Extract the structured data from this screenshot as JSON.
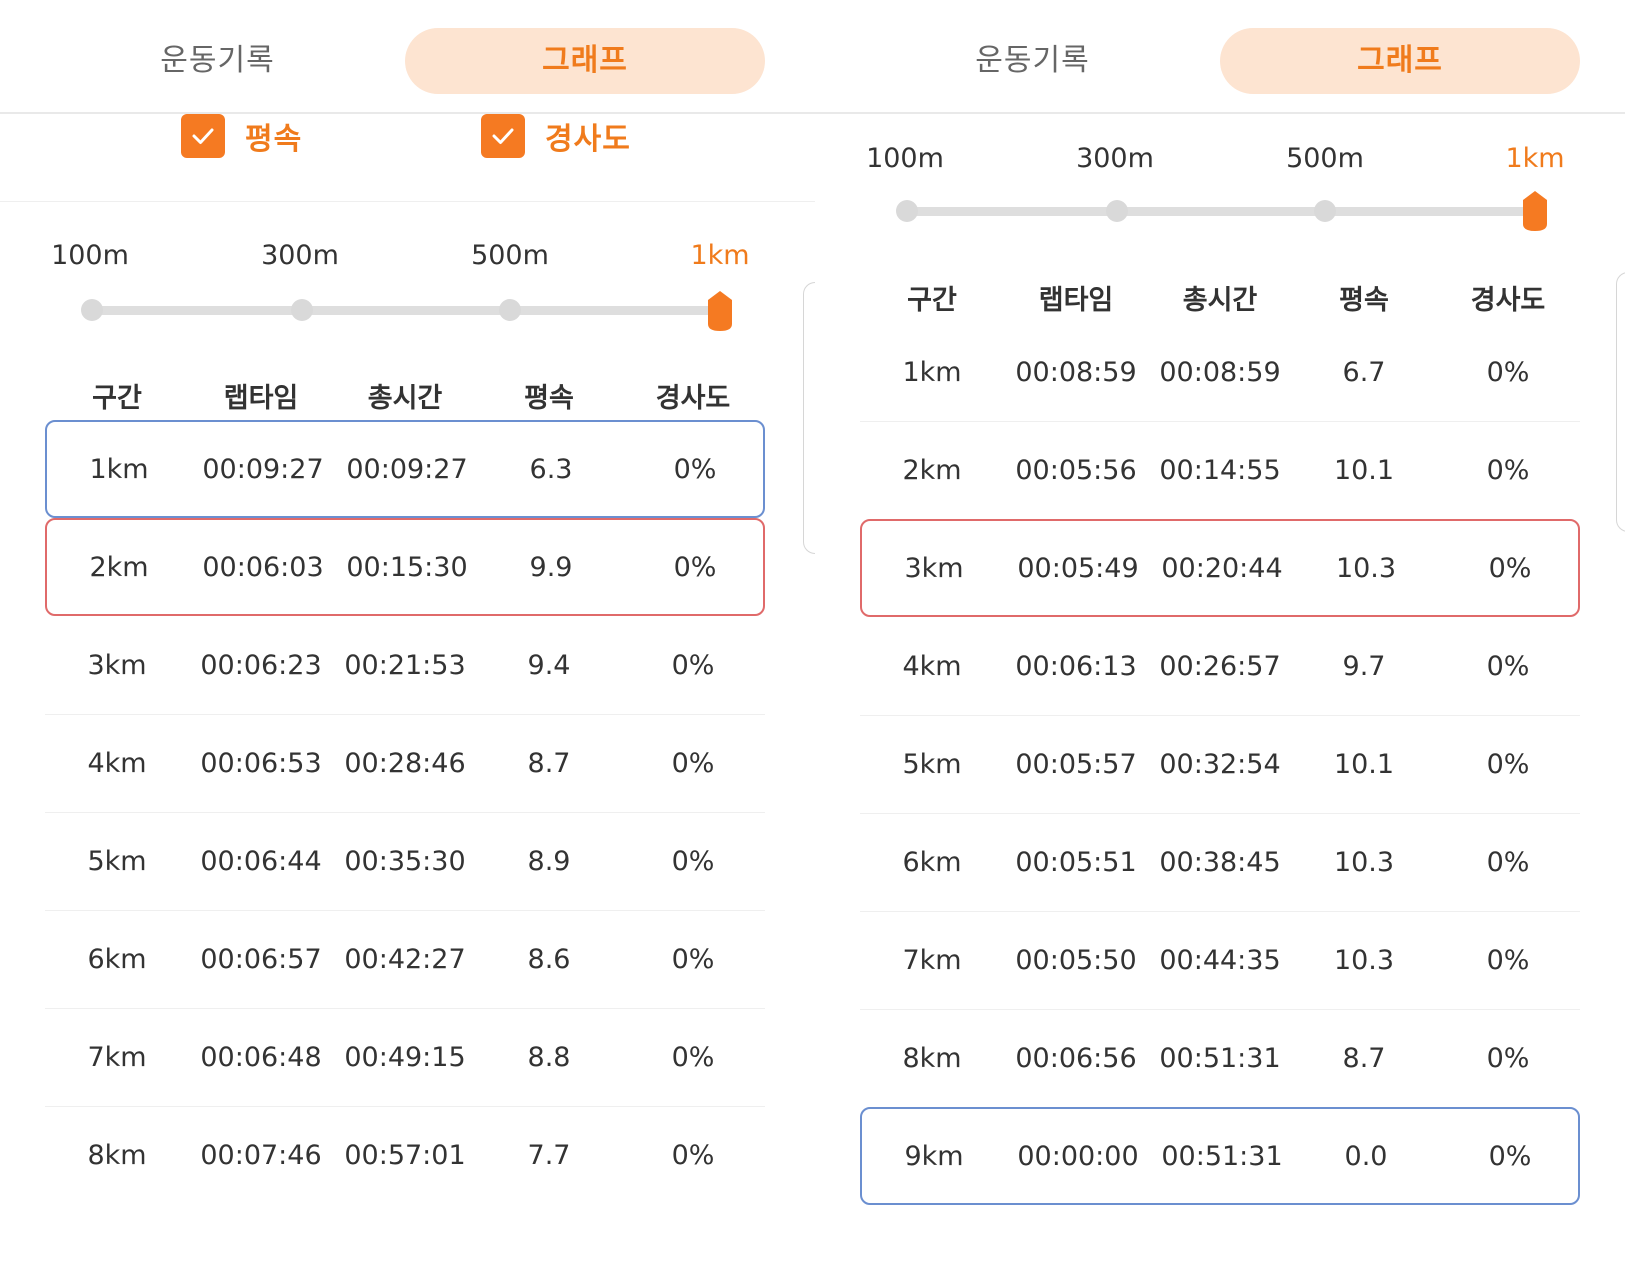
{
  "tabs": {
    "record": "운동기록",
    "graph": "그래프"
  },
  "filters": {
    "speed": "평속",
    "slope": "경사도",
    "speed_checked": true,
    "slope_checked": true
  },
  "slider": {
    "options": [
      "100m",
      "300m",
      "500m",
      "1km"
    ],
    "selected": "1km"
  },
  "table": {
    "headers": [
      "구간",
      "랩타임",
      "총시간",
      "평속",
      "경사도"
    ]
  },
  "left": {
    "rows": [
      [
        "1km",
        "00:09:27",
        "00:09:27",
        "6.3",
        "0%"
      ],
      [
        "2km",
        "00:06:03",
        "00:15:30",
        "9.9",
        "0%"
      ],
      [
        "3km",
        "00:06:23",
        "00:21:53",
        "9.4",
        "0%"
      ],
      [
        "4km",
        "00:06:53",
        "00:28:46",
        "8.7",
        "0%"
      ],
      [
        "5km",
        "00:06:44",
        "00:35:30",
        "8.9",
        "0%"
      ],
      [
        "6km",
        "00:06:57",
        "00:42:27",
        "8.6",
        "0%"
      ],
      [
        "7km",
        "00:06:48",
        "00:49:15",
        "8.8",
        "0%"
      ],
      [
        "8km",
        "00:07:46",
        "00:57:01",
        "7.7",
        "0%"
      ]
    ],
    "highlight_blue": "1km",
    "highlight_red": "2km"
  },
  "right": {
    "rows": [
      [
        "1km",
        "00:08:59",
        "00:08:59",
        "6.7",
        "0%"
      ],
      [
        "2km",
        "00:05:56",
        "00:14:55",
        "10.1",
        "0%"
      ],
      [
        "3km",
        "00:05:49",
        "00:20:44",
        "10.3",
        "0%"
      ],
      [
        "4km",
        "00:06:13",
        "00:26:57",
        "9.7",
        "0%"
      ],
      [
        "5km",
        "00:05:57",
        "00:32:54",
        "10.1",
        "0%"
      ],
      [
        "6km",
        "00:05:51",
        "00:38:45",
        "10.3",
        "0%"
      ],
      [
        "7km",
        "00:05:50",
        "00:44:35",
        "10.3",
        "0%"
      ],
      [
        "8km",
        "00:06:56",
        "00:51:31",
        "8.7",
        "0%"
      ],
      [
        "9km",
        "00:00:00",
        "00:51:31",
        "0.0",
        "0%"
      ]
    ],
    "highlight_blue": "9km",
    "highlight_red": "3km"
  },
  "colors": {
    "accent": "#f07b1c",
    "tab_active_bg": "#fde4d1",
    "highlight_blue": "#6b8fd0",
    "highlight_red": "#e06a6a"
  },
  "icons": {
    "checkbox": "check-icon",
    "slider_thumb": "slider-thumb-icon"
  }
}
